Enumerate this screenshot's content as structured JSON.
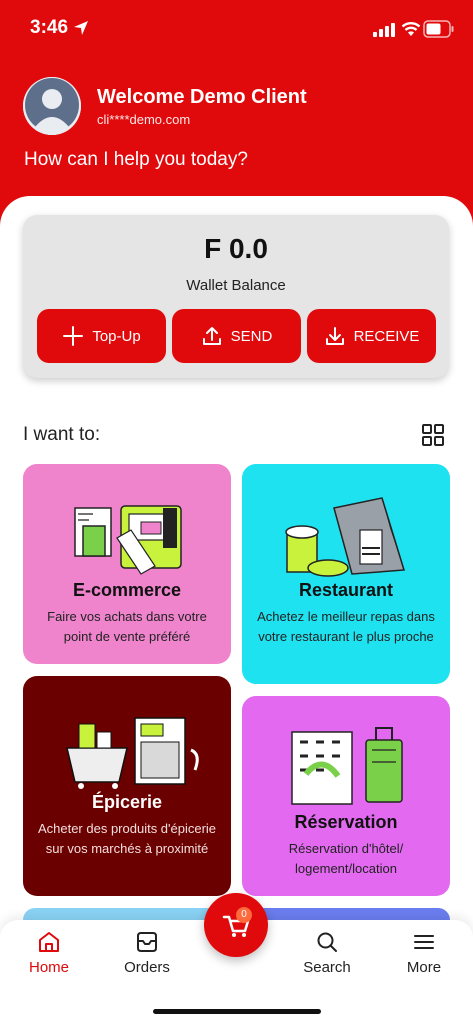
{
  "status": {
    "time": "3:46"
  },
  "header": {
    "welcome": "Welcome Demo Client",
    "email": "cli****demo.com",
    "help": "How can I help you today?"
  },
  "wallet": {
    "balance": "F 0.0",
    "label": "Wallet Balance",
    "topup": "Top-Up",
    "send": "SEND",
    "receive": "RECEIVE"
  },
  "section": {
    "title": "I want to:"
  },
  "cards": [
    {
      "title": "E-commerce",
      "desc": "Faire vos achats dans votre point de vente préféré",
      "color": "#ef84cd"
    },
    {
      "title": "Restaurant",
      "desc": "Achetez le meilleur repas dans votre restaurant le plus proche",
      "color": "#1fe2f0"
    },
    {
      "title": "Épicerie",
      "desc": "Acheter des produits d'épicerie sur vos marchés à proximité",
      "color": "#6b0000"
    },
    {
      "title": "Réservation",
      "desc": "Réservation d'hôtel/ logement/location",
      "color": "#e36af0"
    }
  ],
  "nav": {
    "home": "Home",
    "orders": "Orders",
    "search": "Search",
    "more": "More",
    "cart_count": "0"
  },
  "colors": {
    "primary": "#e00a0c",
    "accent_lime": "#c8f23c"
  }
}
